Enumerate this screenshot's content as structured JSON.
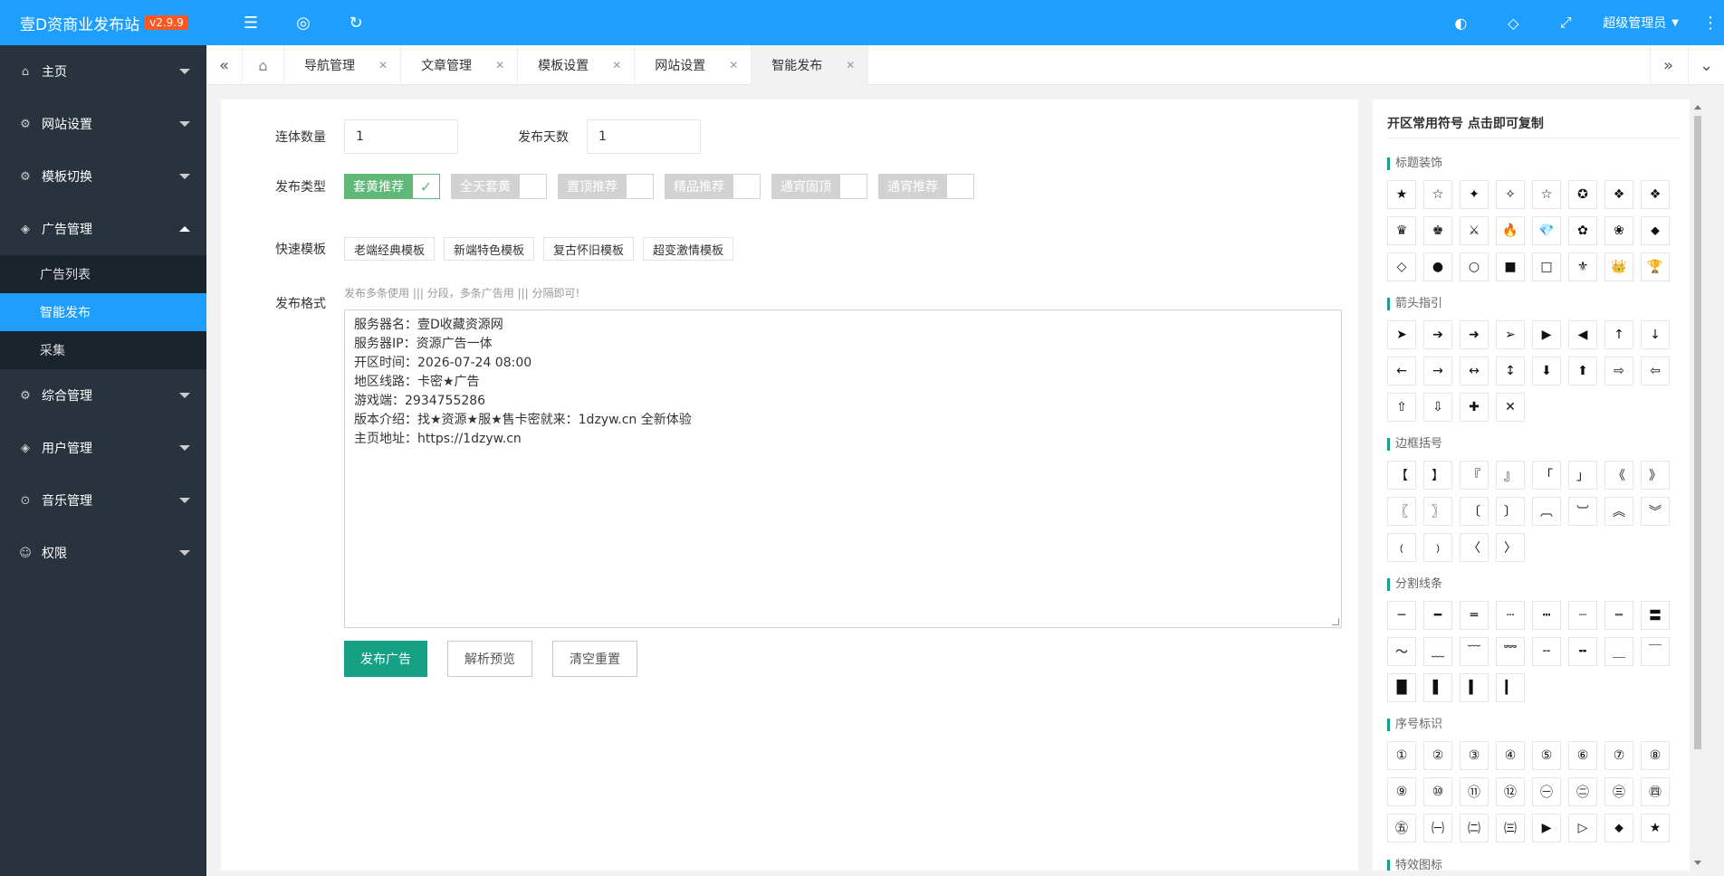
{
  "header": {
    "app_title": "壹D资商业发布站",
    "version": "v2.9.9",
    "left_icons": [
      "menu-fold-icon",
      "globe-icon",
      "refresh-icon"
    ],
    "right_icons": [
      "palette-icon",
      "tag-icon",
      "fullscreen-icon"
    ],
    "user_label": "超级管理员",
    "more_icon": "more-vertical-icon"
  },
  "sidebar": {
    "items": [
      {
        "label": "主页",
        "icon": "home-icon"
      },
      {
        "label": "网站设置",
        "icon": "gear-icon"
      },
      {
        "label": "模板切换",
        "icon": "gear-icon"
      },
      {
        "label": "广告管理",
        "icon": "diamond-icon"
      },
      {
        "label": "综合管理",
        "icon": "gear-icon"
      },
      {
        "label": "用户管理",
        "icon": "diamond-icon"
      },
      {
        "label": "音乐管理",
        "icon": "download-icon"
      },
      {
        "label": "权限",
        "icon": "user-icon"
      }
    ],
    "sub_items": [
      "广告列表",
      "智能发布",
      "采集"
    ]
  },
  "tabs": {
    "items": [
      "导航管理",
      "文章管理",
      "模板设置",
      "网站设置",
      "智能发布"
    ],
    "active": "智能发布"
  },
  "form": {
    "count_label": "连体数量",
    "count_value": "1",
    "days_label": "发布天数",
    "days_value": "1",
    "type_label": "发布类型",
    "types": [
      {
        "label": "套黄推荐",
        "on": true
      },
      {
        "label": "全天套黄",
        "on": false
      },
      {
        "label": "置顶推荐",
        "on": false
      },
      {
        "label": "精品推荐",
        "on": false
      },
      {
        "label": "通宵固顶",
        "on": false
      },
      {
        "label": "通宵推荐",
        "on": false
      }
    ],
    "template_label": "快速模板",
    "templates": [
      "老端经典模板",
      "新端特色模板",
      "复古怀旧模板",
      "超变激情模板"
    ],
    "format_label": "发布格式",
    "format_hint": "发布多条使用 ||| 分段，多条广告用 ||| 分隔即可!",
    "content_lines": [
      "服务器名：壹D收藏资源网",
      "服务器IP：资源广告一体",
      "开区时间：2026-07-24 08:00",
      "地区线路：卡密★广告",
      "游戏端：2934755286",
      "版本介绍：找★资源★服★售卡密就来：1dzyw.cn 全新体验",
      "主页地址：https://1dzyw.cn"
    ],
    "publish_button": "发布广告",
    "preview_button": "解析预览",
    "reset_button": "清空重置"
  },
  "symbols": {
    "title": "开区常用符号 点击即可复制",
    "sections": [
      {
        "title": "标题装饰",
        "items": [
          "★",
          "☆",
          "✦",
          "✧",
          "☆",
          "✪",
          "❖",
          "❖",
          "♛",
          "♚",
          "⚔",
          "🔥",
          "💎",
          "✿",
          "❀",
          "⬥",
          "◇",
          "●",
          "○",
          "■",
          "□",
          "⚜",
          "👑",
          "🏆"
        ]
      },
      {
        "title": "箭头指引",
        "items": [
          "➤",
          "➔",
          "➜",
          "➢",
          "▶",
          "◀",
          "↑",
          "↓",
          "←",
          "→",
          "↔",
          "↕",
          "⬇",
          "⬆",
          "⇨",
          "⇦",
          "⇧",
          "⇩",
          "✚",
          "✕"
        ]
      },
      {
        "title": "边框括号",
        "items": [
          "【",
          "】",
          "『",
          "』",
          "「",
          "」",
          "《",
          "》",
          "〖",
          "〗",
          "〔",
          "〕",
          "︹",
          "︺",
          "︽",
          "︾",
          "﹙",
          "﹚",
          "〈",
          "〉"
        ]
      },
      {
        "title": "分割线条",
        "items": [
          "─",
          "━",
          "═",
          "┄",
          "┅",
          "┈",
          "┉",
          "〓",
          "～",
          "﹏",
          "﹋",
          "﹌",
          "╌",
          "╍",
          "＿",
          "￣",
          "█",
          "▌",
          "▍",
          "▎"
        ]
      },
      {
        "title": "序号标识",
        "items": [
          "①",
          "②",
          "③",
          "④",
          "⑤",
          "⑥",
          "⑦",
          "⑧",
          "⑨",
          "⑩",
          "⑪",
          "⑫",
          "㊀",
          "㊁",
          "㊂",
          "㊃",
          "㊄",
          "㈠",
          "㈡",
          "㈢",
          "▶",
          "▷",
          "⬥",
          "★"
        ]
      },
      {
        "title": "特效图标",
        "items": []
      }
    ]
  }
}
